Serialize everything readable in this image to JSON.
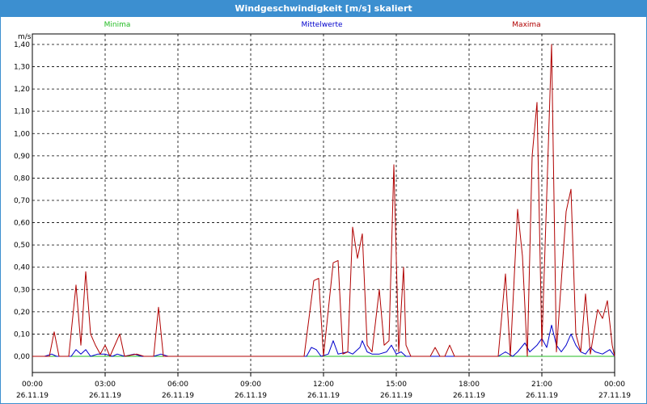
{
  "window": {
    "title": "Windgeschwindigkeit [m/s] skaliert"
  },
  "chart_data": {
    "type": "line",
    "title": "Windgeschwindigkeit [m/s] skaliert",
    "ylabel": "m/s",
    "xlabel": "",
    "ylim": [
      0,
      1.4
    ],
    "y_ticks": [
      "0,00",
      "0,10",
      "0,20",
      "0,30",
      "0,40",
      "0,50",
      "0,60",
      "0,70",
      "0,80",
      "0,90",
      "1,00",
      "1,10",
      "1,20",
      "1,30",
      "1,40"
    ],
    "xlim_hours": [
      0,
      24
    ],
    "x_ticks": [
      {
        "time": "00:00",
        "date": "26.11.19"
      },
      {
        "time": "03:00",
        "date": "26.11.19"
      },
      {
        "time": "06:00",
        "date": "26.11.19"
      },
      {
        "time": "09:00",
        "date": "26.11.19"
      },
      {
        "time": "12:00",
        "date": "26.11.19"
      },
      {
        "time": "15:00",
        "date": "26.11.19"
      },
      {
        "time": "18:00",
        "date": "26.11.19"
      },
      {
        "time": "21:00",
        "date": "26.11.19"
      },
      {
        "time": "00:00",
        "date": "27.11.19"
      }
    ],
    "grid": true,
    "legend_position": "top",
    "series": [
      {
        "name": "Minima",
        "color": "#22bb22",
        "points": [
          [
            0,
            0
          ],
          [
            24,
            0
          ]
        ]
      },
      {
        "name": "Mittelwerte",
        "color": "#0000cc",
        "points": [
          [
            0,
            0
          ],
          [
            0.5,
            0
          ],
          [
            0.8,
            0.01
          ],
          [
            1.0,
            0
          ],
          [
            1.6,
            0
          ],
          [
            1.8,
            0.03
          ],
          [
            2.0,
            0.01
          ],
          [
            2.2,
            0.03
          ],
          [
            2.4,
            0
          ],
          [
            2.7,
            0.01
          ],
          [
            3.0,
            0.01
          ],
          [
            3.3,
            0
          ],
          [
            3.5,
            0.01
          ],
          [
            3.8,
            0
          ],
          [
            4.2,
            0.01
          ],
          [
            4.5,
            0
          ],
          [
            5.0,
            0
          ],
          [
            5.3,
            0.01
          ],
          [
            5.6,
            0
          ],
          [
            11.3,
            0
          ],
          [
            11.5,
            0.04
          ],
          [
            11.7,
            0.03
          ],
          [
            11.9,
            0
          ],
          [
            12.2,
            0.01
          ],
          [
            12.4,
            0.07
          ],
          [
            12.6,
            0.01
          ],
          [
            13.0,
            0.02
          ],
          [
            13.2,
            0.01
          ],
          [
            13.5,
            0.04
          ],
          [
            13.6,
            0.07
          ],
          [
            13.8,
            0.02
          ],
          [
            14.0,
            0.01
          ],
          [
            14.3,
            0.01
          ],
          [
            14.6,
            0.02
          ],
          [
            14.8,
            0.05
          ],
          [
            15.0,
            0.01
          ],
          [
            15.2,
            0.02
          ],
          [
            15.4,
            0
          ],
          [
            19.2,
            0
          ],
          [
            19.5,
            0.02
          ],
          [
            19.8,
            0
          ],
          [
            20.0,
            0.02
          ],
          [
            20.3,
            0.06
          ],
          [
            20.5,
            0.02
          ],
          [
            20.8,
            0.05
          ],
          [
            21.0,
            0.08
          ],
          [
            21.2,
            0.04
          ],
          [
            21.4,
            0.14
          ],
          [
            21.6,
            0.05
          ],
          [
            21.8,
            0.02
          ],
          [
            22.0,
            0.05
          ],
          [
            22.2,
            0.1
          ],
          [
            22.4,
            0.05
          ],
          [
            22.6,
            0.02
          ],
          [
            22.8,
            0.01
          ],
          [
            23.0,
            0.04
          ],
          [
            23.2,
            0.02
          ],
          [
            23.5,
            0.01
          ],
          [
            23.8,
            0.03
          ],
          [
            24,
            0
          ]
        ]
      },
      {
        "name": "Maxima",
        "color": "#b00000",
        "points": [
          [
            0,
            0
          ],
          [
            0.7,
            0
          ],
          [
            0.9,
            0.11
          ],
          [
            1.1,
            0
          ],
          [
            1.5,
            0
          ],
          [
            1.8,
            0.32
          ],
          [
            2.0,
            0.05
          ],
          [
            2.2,
            0.38
          ],
          [
            2.4,
            0.1
          ],
          [
            2.6,
            0.05
          ],
          [
            2.8,
            0.01
          ],
          [
            3.0,
            0.05
          ],
          [
            3.2,
            0
          ],
          [
            3.6,
            0.1
          ],
          [
            3.8,
            0
          ],
          [
            4.3,
            0.01
          ],
          [
            4.6,
            0
          ],
          [
            5.0,
            0
          ],
          [
            5.2,
            0.22
          ],
          [
            5.4,
            0
          ],
          [
            5.8,
            0
          ],
          [
            11.2,
            0
          ],
          [
            11.6,
            0.34
          ],
          [
            11.8,
            0.35
          ],
          [
            12.0,
            0
          ],
          [
            12.4,
            0.42
          ],
          [
            12.6,
            0.43
          ],
          [
            12.8,
            0.01
          ],
          [
            13.0,
            0.02
          ],
          [
            13.2,
            0.58
          ],
          [
            13.4,
            0.44
          ],
          [
            13.6,
            0.55
          ],
          [
            13.8,
            0.05
          ],
          [
            14.0,
            0.02
          ],
          [
            14.3,
            0.3
          ],
          [
            14.5,
            0.05
          ],
          [
            14.7,
            0.07
          ],
          [
            14.9,
            0.86
          ],
          [
            15.1,
            0.02
          ],
          [
            15.3,
            0.4
          ],
          [
            15.4,
            0.05
          ],
          [
            15.6,
            0
          ],
          [
            16.4,
            0
          ],
          [
            16.6,
            0.04
          ],
          [
            16.8,
            0
          ],
          [
            17.0,
            0
          ],
          [
            17.2,
            0.05
          ],
          [
            17.4,
            0
          ],
          [
            19.2,
            0
          ],
          [
            19.5,
            0.37
          ],
          [
            19.7,
            0
          ],
          [
            20.0,
            0.66
          ],
          [
            20.2,
            0.45
          ],
          [
            20.4,
            0
          ],
          [
            20.6,
            0.9
          ],
          [
            20.8,
            1.14
          ],
          [
            21.0,
            0.05
          ],
          [
            21.2,
            0.72
          ],
          [
            21.4,
            1.4
          ],
          [
            21.6,
            0.02
          ],
          [
            22.0,
            0.65
          ],
          [
            22.2,
            0.75
          ],
          [
            22.4,
            0.1
          ],
          [
            22.6,
            0.02
          ],
          [
            22.8,
            0.28
          ],
          [
            23.0,
            0.01
          ],
          [
            23.3,
            0.21
          ],
          [
            23.5,
            0.17
          ],
          [
            23.7,
            0.25
          ],
          [
            23.9,
            0.05
          ],
          [
            24,
            0
          ]
        ]
      }
    ]
  }
}
